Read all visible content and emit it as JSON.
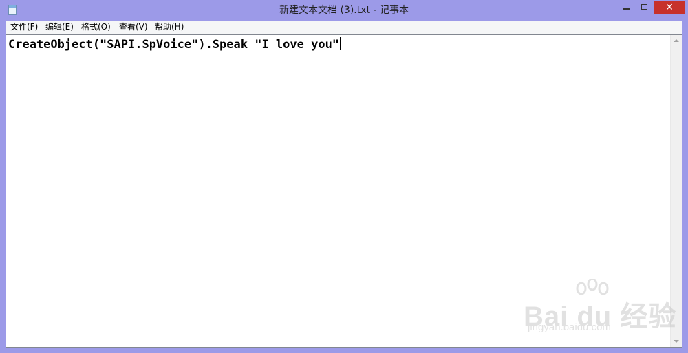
{
  "window": {
    "title": "新建文本文档 (3).txt - 记事本",
    "icon": "notepad-icon",
    "controls": {
      "minimize_icon": "minimize-icon",
      "maximize_icon": "maximize-icon",
      "close_glyph": "✕"
    }
  },
  "menubar": {
    "items": [
      {
        "label": "文件(F)"
      },
      {
        "label": "编辑(E)"
      },
      {
        "label": "格式(O)"
      },
      {
        "label": "查看(V)"
      },
      {
        "label": "帮助(H)"
      }
    ]
  },
  "editor": {
    "content": "CreateObject(\"SAPI.SpVoice\").Speak \"I love you\""
  },
  "watermark": {
    "brand": "Bai du 经验",
    "url": "jingyan.baidu.com"
  },
  "colors": {
    "titlebar": "#9c9ae8",
    "close_button": "#c7312b",
    "menubar": "#f5f6f7"
  }
}
